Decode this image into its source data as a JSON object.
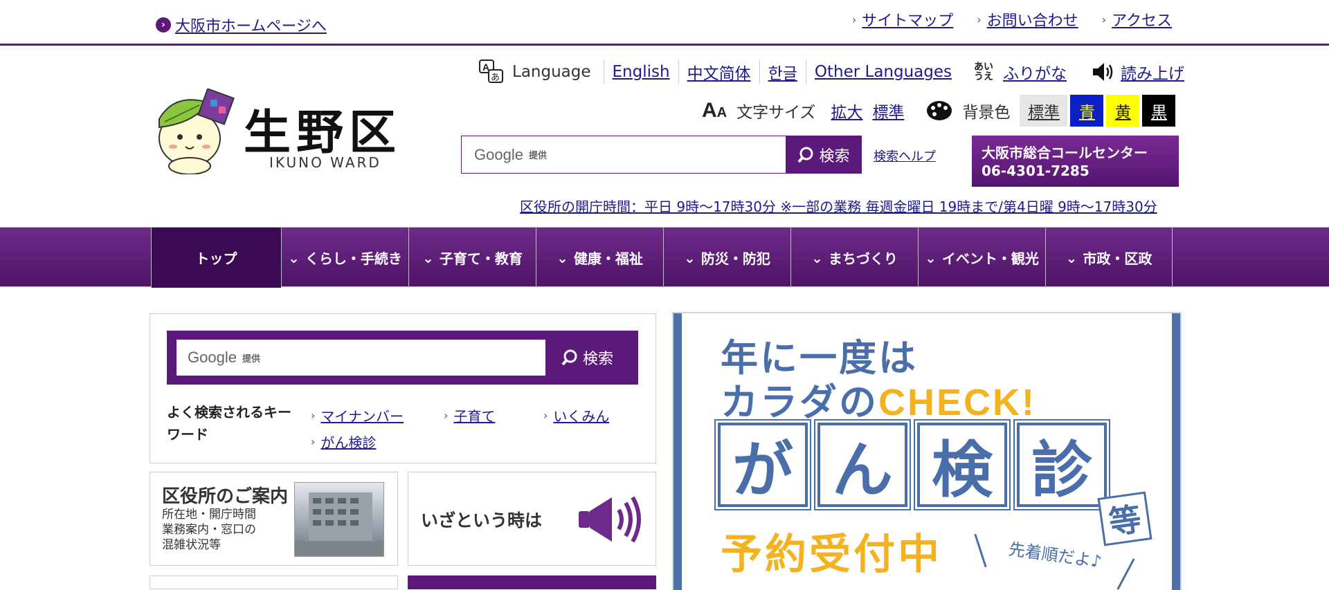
{
  "top": {
    "home_link": "大阪市ホームページへ",
    "links": [
      "サイトマップ",
      "お問い合わせ",
      "アクセス"
    ]
  },
  "logo": {
    "title": "生野区",
    "subtitle": "IKUNO WARD"
  },
  "language": {
    "label": "Language",
    "options": [
      "English",
      "中文简体",
      "한글",
      "Other Languages"
    ],
    "furigana": "ふりがな",
    "read_aloud": "読み上げ"
  },
  "text_size": {
    "label": "文字サイズ",
    "enlarge": "拡大",
    "standard": "標準"
  },
  "background": {
    "label": "背景色",
    "options": [
      {
        "label": "標準",
        "bg": "#e6e6e6",
        "fg": "#333333"
      },
      {
        "label": "青",
        "bg": "#0a1fc4",
        "fg": "#ffff00"
      },
      {
        "label": "黄",
        "bg": "#ffff00",
        "fg": "#222222"
      },
      {
        "label": "黒",
        "bg": "#000000",
        "fg": "#ffffff"
      }
    ]
  },
  "header_search": {
    "google_logo": "Google",
    "provided": "提供",
    "button": "検索",
    "help": "検索ヘルプ"
  },
  "call_center": {
    "name": "大阪市総合コールセンター",
    "phone": "06-4301-7285"
  },
  "hours": "区役所の開庁時間：平日 9時～17時30分 ※一部の業務 毎週金曜日 19時まで/第4日曜 9時～17時30分",
  "nav": {
    "items": [
      "トップ",
      "くらし・手続き",
      "子育て・教育",
      "健康・福祉",
      "防災・防犯",
      "まちづくり",
      "イベント・観光",
      "市政・区政"
    ]
  },
  "main_search": {
    "google_logo": "Google",
    "provided": "提供",
    "button": "検索",
    "keywords_label": "よく検索されるキーワード",
    "keywords": [
      "マイナンバー",
      "子育て",
      "いくみん",
      "がん検診"
    ]
  },
  "cards": {
    "office": {
      "title": "区役所のご案内",
      "desc_lines": [
        "所在地・開庁時間",
        "業務案内・窓口の",
        "混雑状況等"
      ]
    },
    "emergency": {
      "title": "いざという時は"
    }
  },
  "banner": {
    "line1": "年に一度は",
    "line2_prefix": "カラダの",
    "line2_check": "CHECK!",
    "boxes": [
      "が",
      "ん",
      "検",
      "診"
    ],
    "tou": "等",
    "reservation": "予約受付中",
    "first_come": "先着順だよ♪"
  },
  "colors": {
    "brand_purple": "#5b1a7a",
    "banner_blue": "#4a6ea9",
    "banner_yellow": "#f5b21f"
  }
}
